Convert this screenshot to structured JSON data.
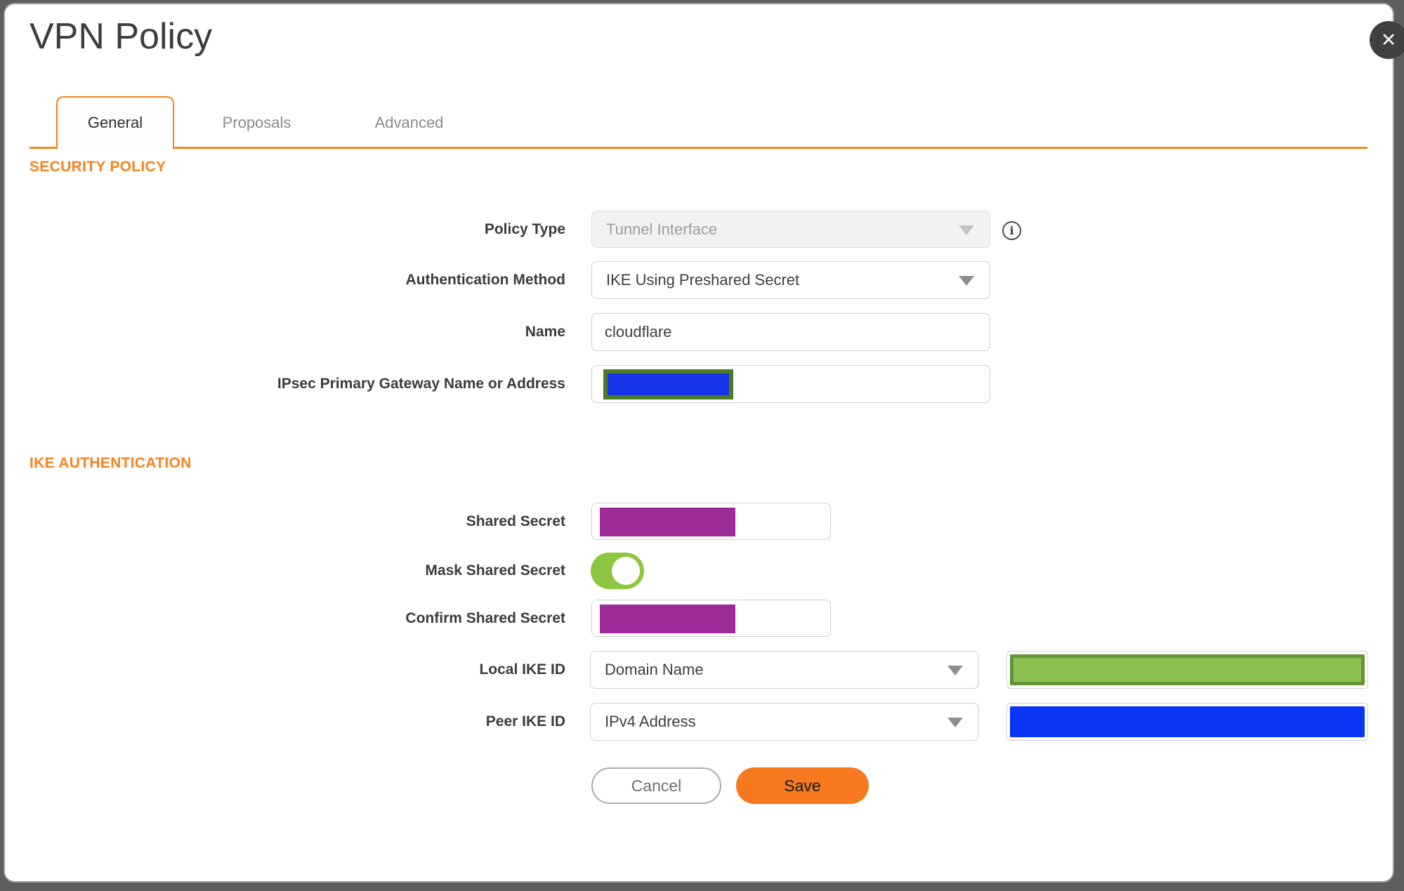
{
  "window": {
    "title": "VPN Policy"
  },
  "icons": {
    "close": "✕",
    "info": "i",
    "dropdown": "triangle-down"
  },
  "tabs": {
    "general": "General",
    "proposals": "Proposals",
    "advanced": "Advanced",
    "active_tab": "General"
  },
  "sections": {
    "security_policy": "SECURITY POLICY",
    "ike_authentication": "IKE AUTHENTICATION"
  },
  "fields": {
    "policy_type": {
      "label": "Policy Type",
      "value": "Tunnel Interface",
      "state": "disabled"
    },
    "authentication_method": {
      "label": "Authentication Method",
      "value": "IKE Using Preshared Secret"
    },
    "name": {
      "label": "Name",
      "value": "cloudflare"
    },
    "gateway": {
      "label": "IPsec Primary Gateway Name or Address",
      "value": "",
      "redacted": true
    },
    "shared_secret": {
      "label": "Shared Secret",
      "value": "",
      "redacted": true
    },
    "mask_shared_secret": {
      "label": "Mask Shared Secret",
      "state": "on"
    },
    "confirm_shared_secret": {
      "label": "Confirm Shared Secret",
      "value": "",
      "redacted": true
    },
    "local_ike_id": {
      "label": "Local IKE ID",
      "value": "Domain Name",
      "id_value": "",
      "id_value_redacted": true
    },
    "peer_ike_id": {
      "label": "Peer IKE ID",
      "value": "IPv4 Address",
      "id_value": "",
      "id_value_redacted": true
    }
  },
  "buttons": {
    "cancel": "Cancel",
    "save": "Save"
  },
  "colors": {
    "accent_orange": "#f78220",
    "save_orange": "#f6791f",
    "backdrop": "#5e5e5e",
    "toggle_green": "#8dc63f",
    "redact_purple": "#9c2b9a",
    "redact_blue": "#0b35f5",
    "redact_blue_fill": "#1733e8",
    "redact_olive": "#4d7b25",
    "redact_green_fill": "#8cc152",
    "redact_green_border": "#649238",
    "close_bg": "#404040"
  }
}
